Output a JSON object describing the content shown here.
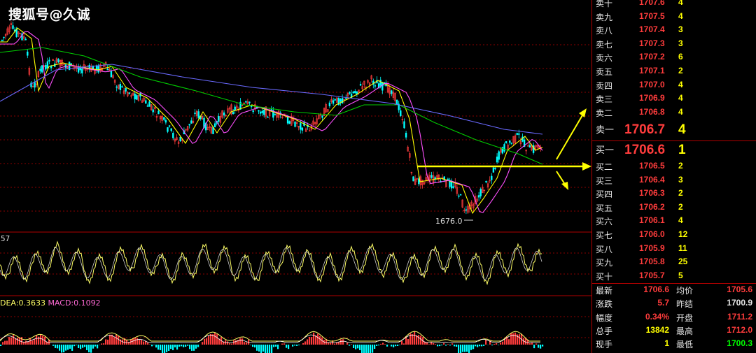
{
  "watermark": "搜狐号@久诚",
  "low_label": "1676.0",
  "kdj_label": "57",
  "macd_label": {
    "dea": "DEA:0.3633",
    "macd": "MACD:0.1092"
  },
  "colors": {
    "up": "#ff3c3c",
    "down": "#00ffff",
    "ma5": "#ffffff",
    "ma10": "#ffff00",
    "ma20": "#ff4fff",
    "ma60": "#00cc00",
    "ma120": "#6a6aff",
    "annotation": "#ffff00",
    "grid": "#8b0000"
  },
  "sell_levels": [
    {
      "name": "卖十",
      "price": "1707.6",
      "vol": "4"
    },
    {
      "name": "卖九",
      "price": "1707.5",
      "vol": "4"
    },
    {
      "name": "卖八",
      "price": "1707.4",
      "vol": "3"
    },
    {
      "name": "卖七",
      "price": "1707.3",
      "vol": "3"
    },
    {
      "name": "卖六",
      "price": "1707.2",
      "vol": "6"
    },
    {
      "name": "卖五",
      "price": "1707.1",
      "vol": "2"
    },
    {
      "name": "卖四",
      "price": "1707.0",
      "vol": "4"
    },
    {
      "name": "卖三",
      "price": "1706.9",
      "vol": "4"
    },
    {
      "name": "卖二",
      "price": "1706.8",
      "vol": "4"
    },
    {
      "name": "卖一",
      "price": "1706.7",
      "vol": "4"
    }
  ],
  "buy_levels": [
    {
      "name": "买一",
      "price": "1706.6",
      "vol": "1"
    },
    {
      "name": "买二",
      "price": "1706.5",
      "vol": "2"
    },
    {
      "name": "买三",
      "price": "1706.4",
      "vol": "3"
    },
    {
      "name": "买四",
      "price": "1706.3",
      "vol": "2"
    },
    {
      "name": "买五",
      "price": "1706.2",
      "vol": "2"
    },
    {
      "name": "买六",
      "price": "1706.1",
      "vol": "4"
    },
    {
      "name": "买七",
      "price": "1706.0",
      "vol": "12"
    },
    {
      "name": "买八",
      "price": "1705.9",
      "vol": "11"
    },
    {
      "name": "买九",
      "price": "1705.8",
      "vol": "25"
    },
    {
      "name": "买十",
      "price": "1705.7",
      "vol": "5"
    }
  ],
  "stats": [
    {
      "l1": "最新",
      "v1": "1706.6",
      "c1": "#ff3c3c",
      "l2": "均价",
      "v2": "1705.6",
      "c2": "#ff3c3c"
    },
    {
      "l1": "涨跌",
      "v1": "5.7",
      "c1": "#ff3c3c",
      "l2": "昨结",
      "v2": "1700.9",
      "c2": "#e6e6e6"
    },
    {
      "l1": "幅度",
      "v1": "0.34%",
      "c1": "#ff3c3c",
      "l2": "开盘",
      "v2": "1711.2",
      "c2": "#ff3c3c"
    },
    {
      "l1": "总手",
      "v1": "13842",
      "c1": "#ffff00",
      "l2": "最高",
      "v2": "1712.0",
      "c2": "#ff3c3c"
    },
    {
      "l1": "现手",
      "v1": "1",
      "c1": "#ffff00",
      "l2": "最低",
      "v2": "1700.3",
      "c2": "#00ff00"
    }
  ]
}
